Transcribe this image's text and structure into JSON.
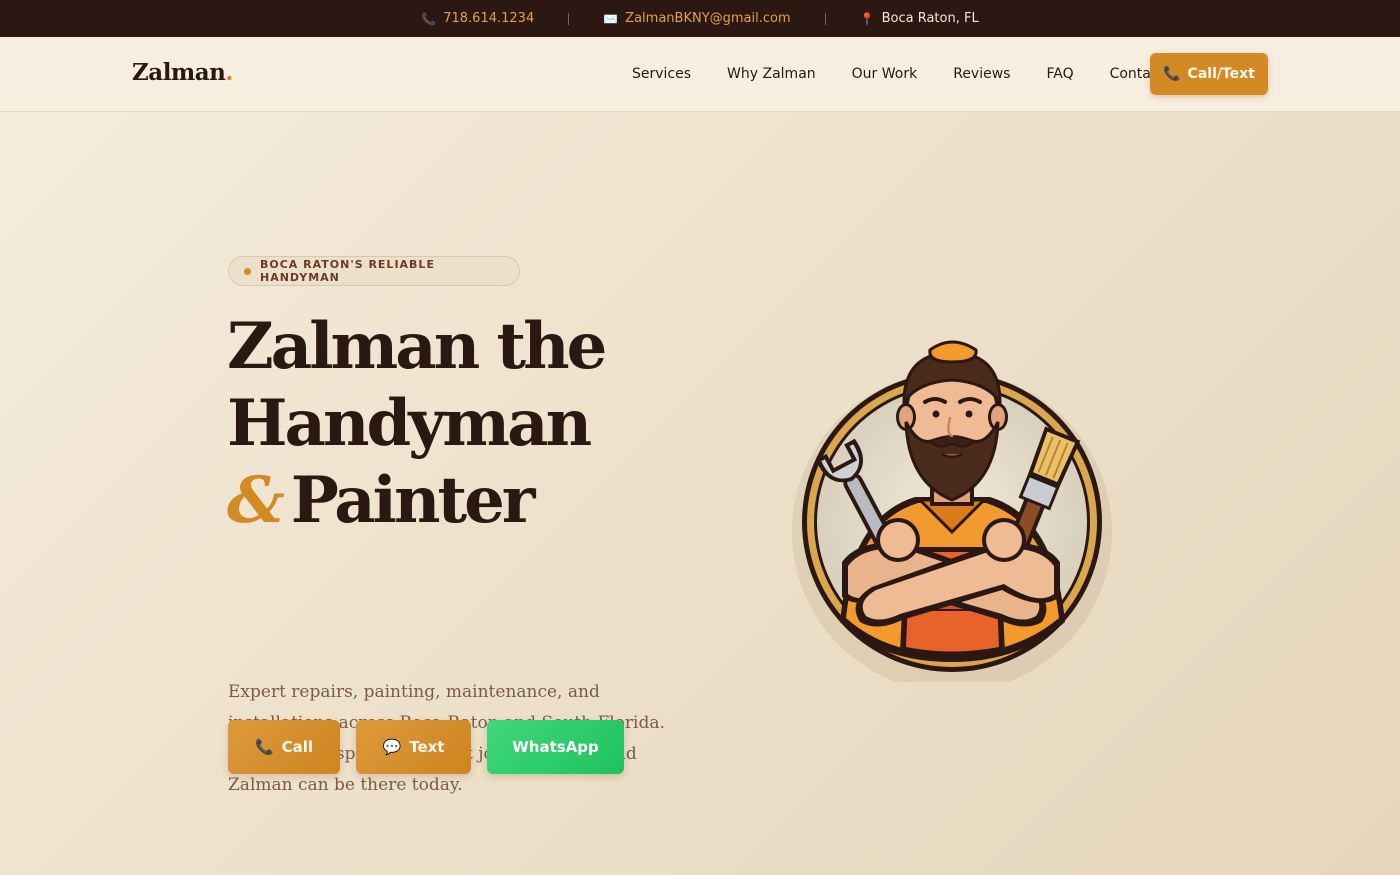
{
  "topbar": {
    "phone": "718.614.1234",
    "email": "ZalmanBKNY@gmail.com",
    "location": "Boca Raton, FL",
    "phone_icon": "📞",
    "email_icon": "✉️",
    "location_icon": "📍"
  },
  "nav": {
    "logo": "Zalman",
    "logo_dot": ".",
    "links": [
      "Services",
      "Why Zalman",
      "Our Work",
      "Reviews",
      "FAQ",
      "Contact"
    ],
    "cta_label": "Call/Text",
    "cta_icon": "📞"
  },
  "hero": {
    "badge": "BOCA RATON'S RELIABLE HANDYMAN",
    "headline_line1": "Zalman the",
    "headline_line2": "Handyman",
    "headline_amp": "&",
    "headline_line3": "Painter",
    "description": "Expert repairs, painting, maintenance, and installations across Boca Raton and South Florida. Same-day response for most jobs. Call now and Zalman can be there today.",
    "buttons": {
      "call": "Call",
      "call_icon": "📞",
      "text": "Text",
      "text_icon": "💬",
      "whatsapp": "WhatsApp"
    }
  },
  "colors": {
    "accent": "#d48a24",
    "dark": "#2b1812",
    "whatsapp": "#25c462"
  }
}
